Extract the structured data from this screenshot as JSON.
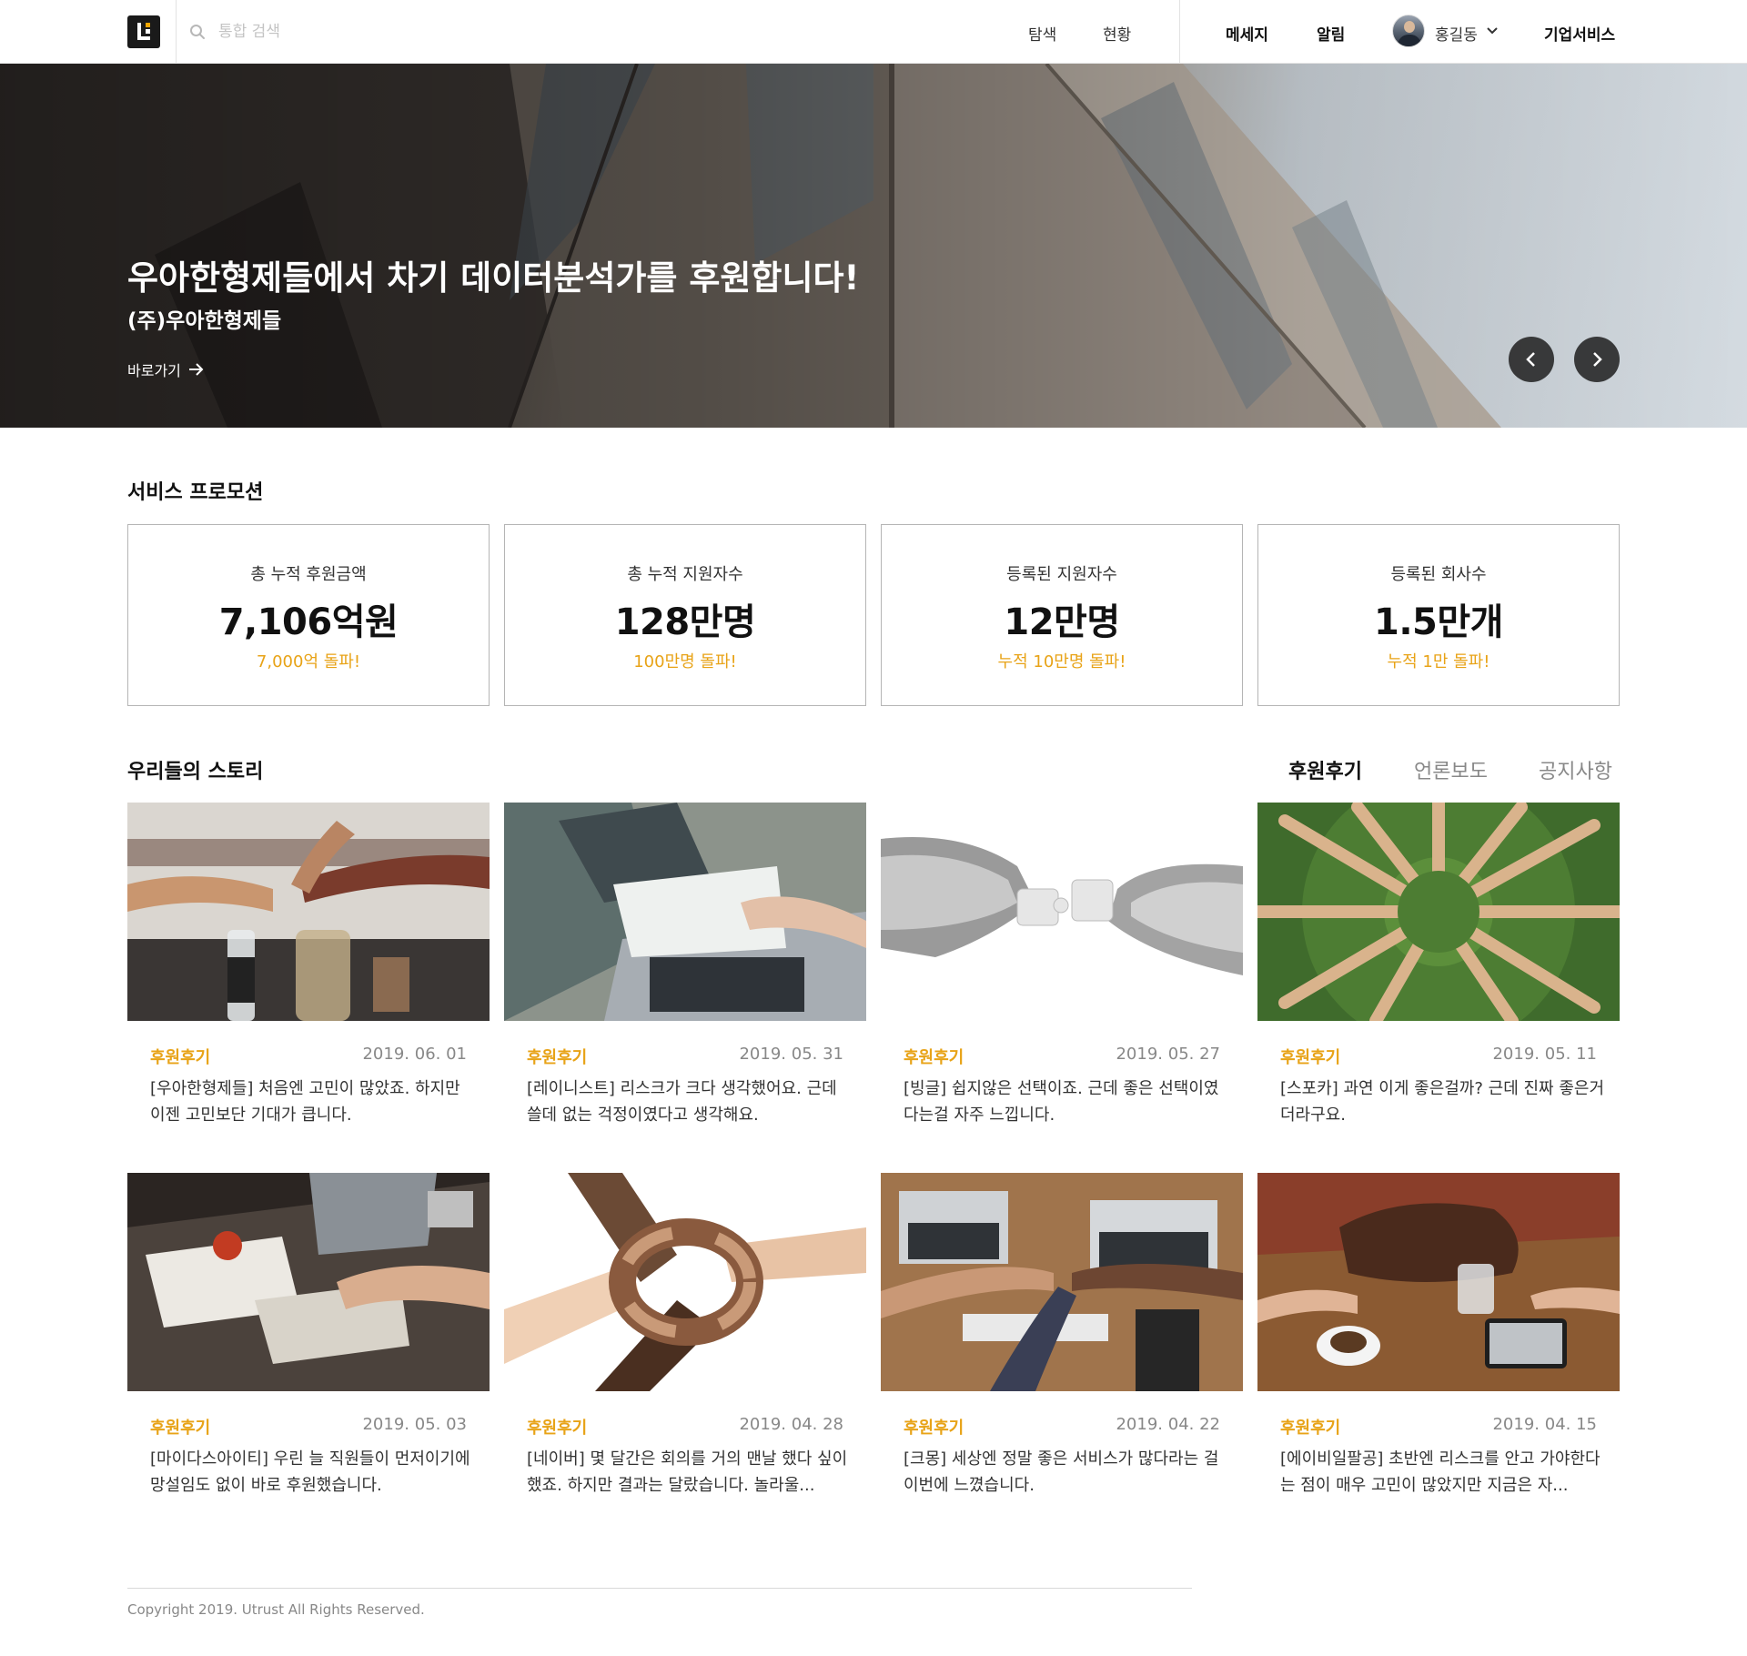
{
  "header": {
    "search_placeholder": "통합 검색",
    "nav": [
      "탐색",
      "현황"
    ],
    "message": "메세지",
    "alarm": "알림",
    "user_name": "홍길동",
    "enterprise": "기업서비스"
  },
  "hero": {
    "title": "우아한형제들에서 차기 데이터분석가를 후원합니다!",
    "subtitle": "(주)우아한형제들",
    "link": "바로가기"
  },
  "promotion": {
    "title": "서비스 프로모션",
    "stats": [
      {
        "label": "총 누적 후원금액",
        "value": "7,106억원",
        "note": "7,000억 돌파!"
      },
      {
        "label": "총 누적 지원자수",
        "value": "128만명",
        "note": "100만명 돌파!"
      },
      {
        "label": "등록된 지원자수",
        "value": "12만명",
        "note": "누적 10만명 돌파!"
      },
      {
        "label": "등록된 회사수",
        "value": "1.5만개",
        "note": "누적 1만 돌파!"
      }
    ]
  },
  "stories": {
    "title": "우리들의 스토리",
    "tabs": [
      "후원후기",
      "언론보도",
      "공지사항"
    ],
    "cards": [
      {
        "category": "후원후기",
        "date": "2019. 06. 01",
        "text": "[우아한형제들] 처음엔 고민이 많았죠. 하지만 이젠 고민보단 기대가 큽니다."
      },
      {
        "category": "후원후기",
        "date": "2019. 05. 31",
        "text": "[레이니스트] 리스크가 크다 생각했어요. 근데 쓸데 없는 걱정이였다고 생각해요."
      },
      {
        "category": "후원후기",
        "date": "2019. 05. 27",
        "text": "[빙글] 쉽지않은 선택이죠. 근데 좋은 선택이였다는걸 자주 느낍니다."
      },
      {
        "category": "후원후기",
        "date": "2019. 05. 11",
        "text": "[스포카] 과연 이게 좋은걸까?  근데 진짜 좋은거더라구요."
      },
      {
        "category": "후원후기",
        "date": "2019. 05. 03",
        "text": "[마이다스아이티] 우린 늘 직원들이 먼저이기에 망설임도 없이 바로 후원했습니다."
      },
      {
        "category": "후원후기",
        "date": "2019. 04. 28",
        "text": "[네이버] 몇 달간은 회의를 거의 맨날 했다 싶이 했죠. 하지만 결과는 달랐습니다. 놀라울..."
      },
      {
        "category": "후원후기",
        "date": "2019. 04. 22",
        "text": "[크몽] 세상엔 정말 좋은 서비스가 많다라는 걸 이번에 느꼈습니다."
      },
      {
        "category": "후원후기",
        "date": "2019. 04. 15",
        "text": "[에이비일팔공] 초반엔 리스크를 안고 가야한다는 점이 매우 고민이 많았지만 지금은 자..."
      }
    ]
  },
  "footer": {
    "copyright": "Copyright 2019. Utrust All Rights Reserved."
  }
}
